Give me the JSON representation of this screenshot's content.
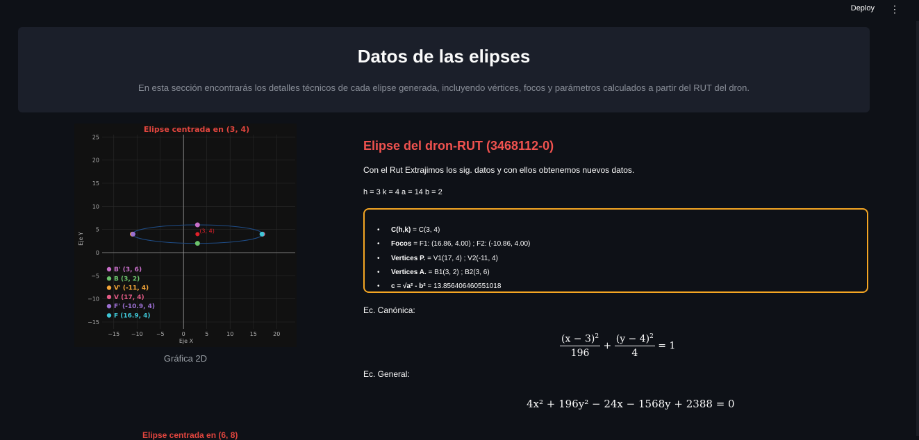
{
  "header": {
    "deploy_label": "Deploy",
    "menu_icon": "kebab-menu-icon"
  },
  "hero": {
    "title": "Datos de las elipses",
    "subtitle": "En esta sección encontrarás los detalles técnicos de cada elipse generada, incluyendo vértices, focos y parámetros calculados a partir del RUT del dron."
  },
  "plot": {
    "caption": "Gráfica 2D",
    "next_title": "Elipse centrada en (6, 8)"
  },
  "chart_data": {
    "type": "scatter",
    "title": "Elipse centrada en (3, 4)",
    "xlabel": "Eje X",
    "ylabel": "Eje Y",
    "xlim": [
      -17.5,
      24
    ],
    "ylim": [
      -16.5,
      25.5
    ],
    "xticks": [
      -15,
      -10,
      -5,
      0,
      5,
      10,
      15,
      20
    ],
    "yticks": [
      -15,
      -10,
      -5,
      0,
      5,
      10,
      15,
      20,
      25
    ],
    "grid": true,
    "legend_position": "lower-left",
    "ellipse": {
      "h": 3,
      "k": 4,
      "a": 14,
      "b": 2,
      "color": "#1f4e8a"
    },
    "center": {
      "x": 3,
      "y": 4,
      "label": "(3, 4)",
      "color": "#e0202a"
    },
    "series": [
      {
        "name": "B' (3, 6)",
        "x": 3,
        "y": 6,
        "color": "#c86fc9"
      },
      {
        "name": "B (3, 2)",
        "x": 3,
        "y": 2,
        "color": "#6cc36c"
      },
      {
        "name": "V' (-11, 4)",
        "x": -11,
        "y": 4,
        "color": "#f5a638"
      },
      {
        "name": "V (17, 4)",
        "x": 17,
        "y": 4,
        "color": "#e45b86"
      },
      {
        "name": "F' (-10.9, 4)",
        "x": -10.86,
        "y": 4,
        "color": "#9b6fd1"
      },
      {
        "name": "F (16.9, 4)",
        "x": 16.86,
        "y": 4,
        "color": "#3fc6d6"
      }
    ]
  },
  "details": {
    "title": "Elipse del dron-RUT (3468112-0)",
    "intro": "Con el Rut Extrajimos los sig. datos y con ellos obtenemos nuevos datos.",
    "params": "h = 3 k = 4 a = 14 b = 2",
    "items": [
      {
        "label": "C(h,k)",
        "value": " = C(3, 4)"
      },
      {
        "label": "Focos",
        "value": " = F1: (16.86, 4.00) ; F2: (-10.86, 4.00)"
      },
      {
        "label": "Vertices P.",
        "value": " = V1(17, 4) ; V2(-11, 4)"
      },
      {
        "label": "Vertices A.",
        "value": " = B1(3, 2) ; B2(3, 6)"
      },
      {
        "label": "c = √a² - b²",
        "value": " = 13.856406460551018"
      }
    ],
    "canonical_label": "Ec. Canónica:",
    "general_label": "Ec. General:",
    "canonical": {
      "num1": "(x − 3)",
      "den1": "196",
      "num2": "(y − 4)",
      "den2": "4",
      "rhs": "= 1"
    },
    "general": "4x² + 196y² − 24x − 1568y + 2388 = 0"
  },
  "colors": {
    "accent": "#f0524f",
    "box_border": "#f5a623",
    "background": "#0e1117",
    "hero_bg": "#1b1f2a"
  }
}
